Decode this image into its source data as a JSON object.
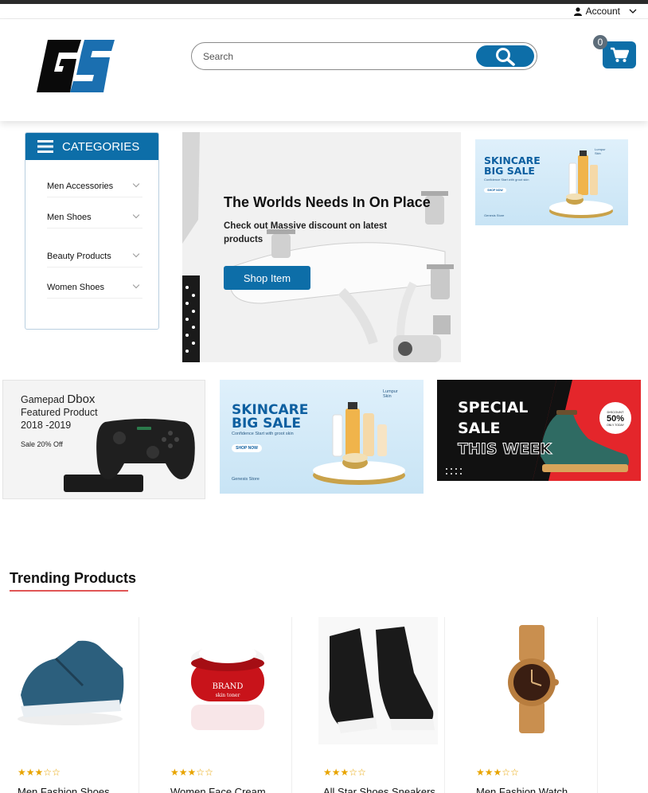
{
  "account": {
    "label": "Account"
  },
  "search": {
    "placeholder": "Search"
  },
  "cart": {
    "count": "0"
  },
  "categories": {
    "heading": "CATEGORIES",
    "items": [
      {
        "label": "Men Accessories"
      },
      {
        "label": "Men Shoes"
      },
      {
        "label": "Beauty Products"
      },
      {
        "label": "Women Shoes"
      }
    ]
  },
  "hero": {
    "title": "The Worlds Needs In On Place",
    "subtitle": "Check out Massive discount on latest products",
    "button": "Shop Item"
  },
  "banners": {
    "skincare": {
      "title_line1": "SKINCARE",
      "title_line2": "BIG SALE",
      "tagline": "Confidence Start with groot skin",
      "button": "SHOP NOW",
      "store": "Genesis Store",
      "brand": "Lumpur Skin"
    },
    "gamepad": {
      "line1_a": "Gamepad",
      "line1_b": "Dbox",
      "line2": "Featured Product",
      "line3": "2018 -2019",
      "sale": "Sale 20% Off"
    },
    "special": {
      "line1": "SPECIAL",
      "line2": "SALE",
      "line3": "THIS WEEK",
      "discount_label": "DISCOUNT",
      "discount_value": "50%",
      "discount_sub": "ONLY TODAY"
    }
  },
  "trending": {
    "title": "Trending Products",
    "products": [
      {
        "name": "Men Fashion Shoes",
        "rating": 3,
        "max": 5
      },
      {
        "name": "Women Face Cream",
        "rating": 3,
        "max": 5
      },
      {
        "name": "All Star Shoes Sneakers",
        "rating": 3,
        "max": 5
      },
      {
        "name": "Men Fashion Watch",
        "rating": 3,
        "max": 5
      }
    ]
  },
  "colors": {
    "primary": "#0d6ea8",
    "accent_red": "#e05555",
    "star": "#e8a400"
  }
}
